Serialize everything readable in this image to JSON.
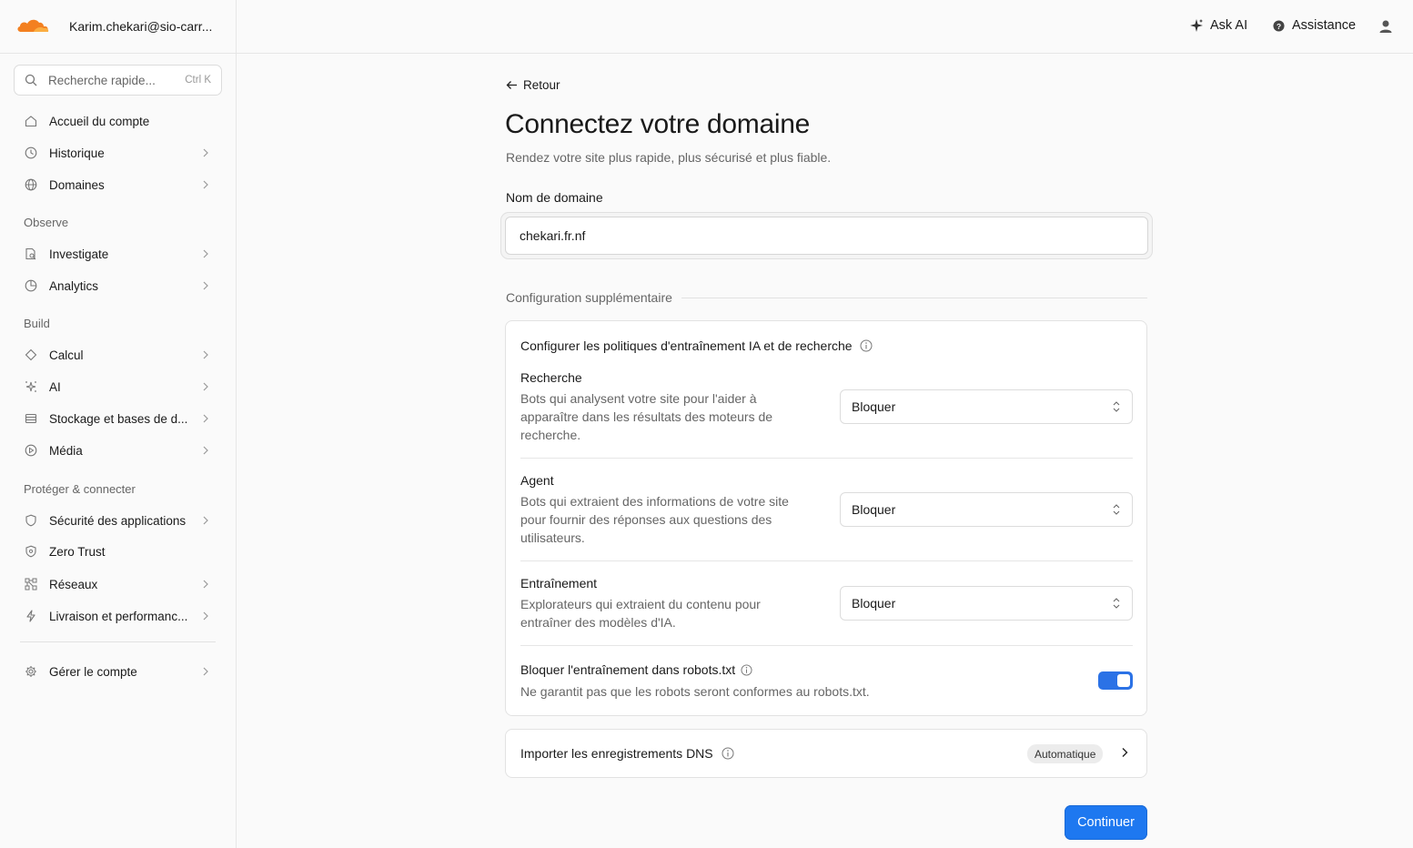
{
  "header": {
    "account_name": "Karim.chekari@sio-carr...",
    "ask_ai_label": "Ask AI",
    "assistance_label": "Assistance",
    "brand_color": "#f38020"
  },
  "sidebar": {
    "search": {
      "placeholder": "Recherche rapide...",
      "shortcut": "Ctrl K"
    },
    "items": [
      {
        "label": "Accueil du compte",
        "icon": "home-icon",
        "has_chevron": false
      },
      {
        "label": "Historique",
        "icon": "clock-icon",
        "has_chevron": true
      },
      {
        "label": "Domaines",
        "icon": "globe-icon",
        "has_chevron": true
      }
    ],
    "sections": [
      {
        "title": "Observe",
        "items": [
          {
            "label": "Investigate",
            "icon": "document-search-icon",
            "has_chevron": true
          },
          {
            "label": "Analytics",
            "icon": "pie-chart-icon",
            "has_chevron": true
          }
        ]
      },
      {
        "title": "Build",
        "items": [
          {
            "label": "Calcul",
            "icon": "diamond-icon",
            "has_chevron": true
          },
          {
            "label": "AI",
            "icon": "sparkles-icon",
            "has_chevron": true
          },
          {
            "label": "Stockage et bases de d...",
            "icon": "database-icon",
            "has_chevron": true
          },
          {
            "label": "Média",
            "icon": "play-icon",
            "has_chevron": true
          }
        ]
      },
      {
        "title": "Protéger & connecter",
        "items": [
          {
            "label": "Sécurité des applications",
            "icon": "shield-icon",
            "has_chevron": true
          },
          {
            "label": "Zero Trust",
            "icon": "shield-lock-icon",
            "has_chevron": false
          },
          {
            "label": "Réseaux",
            "icon": "network-icon",
            "has_chevron": true
          },
          {
            "label": "Livraison et performanc...",
            "icon": "bolt-icon",
            "has_chevron": true
          }
        ]
      }
    ],
    "footer_item": {
      "label": "Gérer le compte",
      "icon": "gear-icon",
      "has_chevron": true
    }
  },
  "main": {
    "back_label": "Retour",
    "title": "Connectez votre domaine",
    "subtitle": "Rendez votre site plus rapide, plus sécurisé et plus fiable.",
    "domain_label": "Nom de domaine",
    "domain_value": "chekari.fr.nf",
    "config_heading": "Configuration supplémentaire",
    "ai_policies": {
      "title": "Configurer les politiques d'entraînement IA et de recherche",
      "policies": [
        {
          "name": "Recherche",
          "description": "Bots qui analysent votre site pour l'aider à apparaître dans les résultats des moteurs de recherche.",
          "value": "Bloquer"
        },
        {
          "name": "Agent",
          "description": "Bots qui extraient des informations de votre site pour fournir des réponses aux questions des utilisateurs.",
          "value": "Bloquer"
        },
        {
          "name": "Entraînement",
          "description": "Explorateurs qui extraient du contenu pour entraîner des modèles d'IA.",
          "value": "Bloquer"
        }
      ],
      "robots": {
        "title": "Bloquer l'entraînement dans robots.txt",
        "description": "Ne garantit pas que les robots seront conformes au robots.txt.",
        "enabled": true
      }
    },
    "dns_import": {
      "title": "Importer les enregistrements DNS",
      "badge": "Automatique"
    },
    "continue_label": "Continuer",
    "accent_color": "#1e78f0"
  }
}
